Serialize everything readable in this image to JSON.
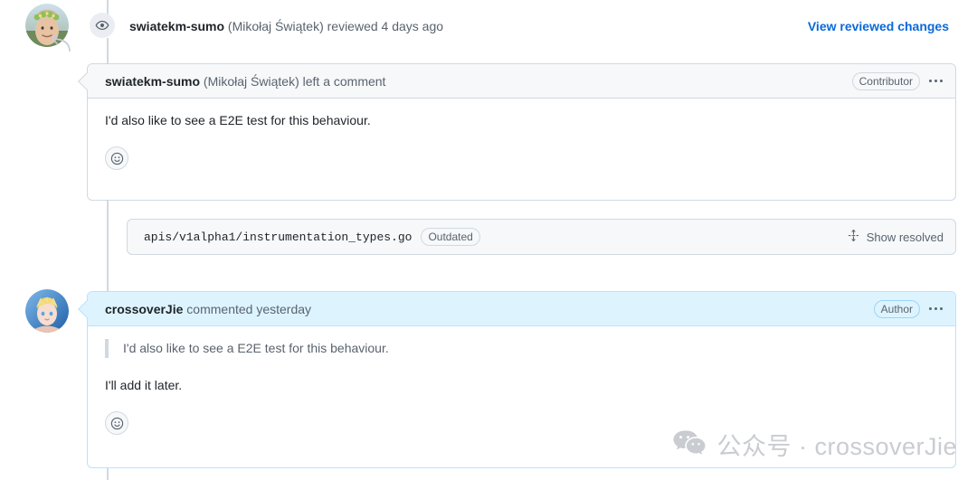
{
  "review_header": {
    "icon": "eye-icon",
    "user": "swiatekm-sumo",
    "rest": " (Mikołaj Świątek) reviewed 4 days ago",
    "view_changes_label": "View reviewed changes",
    "link_color": "#0969da"
  },
  "review_comment": {
    "user": "swiatekm-sumo",
    "rest": " (Mikołaj Świątek) left a comment",
    "badge": "Contributor",
    "menu_icon": "kebab-menu-icon",
    "body": "I'd also like to see a E2E test for this behaviour.",
    "reaction_icon": "smiley-face-icon",
    "header_bg": "#f6f8fa",
    "border": "#d1d9e0"
  },
  "file_row": {
    "path": "apis/v1alpha1/instrumentation_types.go",
    "badge": "Outdated",
    "show_resolved_label": "Show resolved",
    "unfold_icon": "unfold-icon",
    "bg": "#f6f8fa"
  },
  "author_comment": {
    "user": "crossoverJie",
    "rest": " commented yesterday",
    "badge": "Author",
    "menu_icon": "kebab-menu-icon",
    "quote": "I'd also like to see a E2E test for this behaviour.",
    "body": "I'll add it later.",
    "reaction_icon": "smiley-face-icon",
    "header_bg": "#ddf4ff",
    "border": "#b6e3ff"
  },
  "watermark": {
    "icon": "wechat-icon",
    "text": "公众号 · crossoverJie",
    "color": "#c9ccd1"
  }
}
